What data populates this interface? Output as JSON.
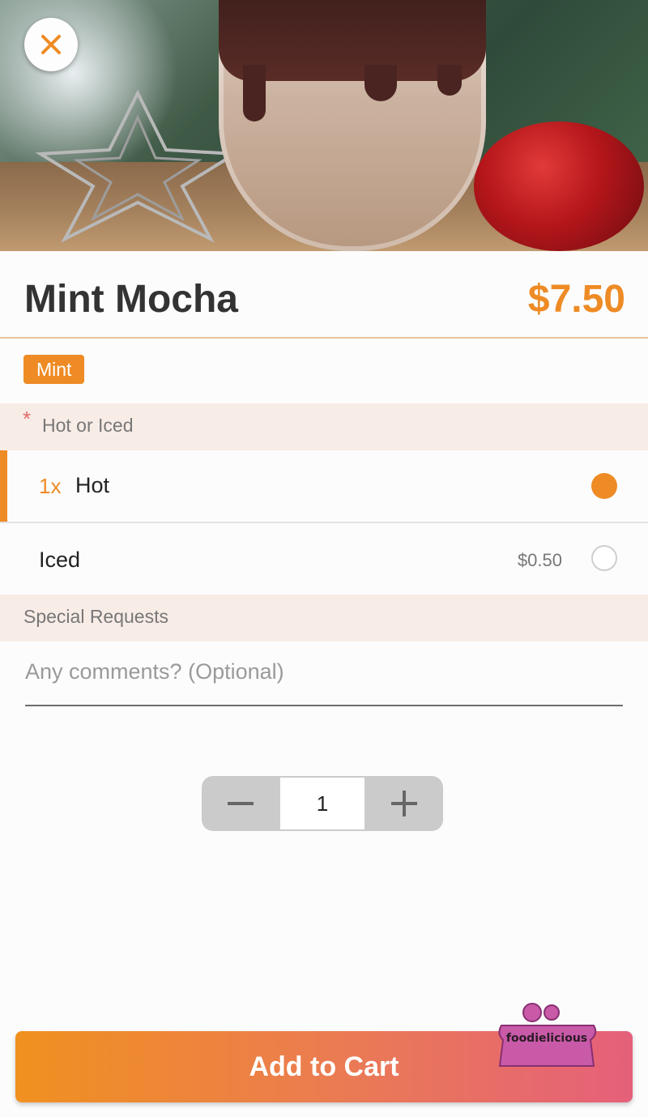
{
  "item": {
    "name": "Mint Mocha",
    "price": "$7.50",
    "tag": "Mint"
  },
  "hero": {
    "image_name": "hero-drink-photo"
  },
  "options": {
    "section_title": "Hot or Iced",
    "required_marker": "*",
    "items": [
      {
        "prefix": "1x",
        "label": "Hot",
        "price": "",
        "selected": true
      },
      {
        "prefix": "",
        "label": "Iced",
        "price": "$0.50",
        "selected": false
      }
    ]
  },
  "special": {
    "section_title": "Special Requests",
    "placeholder": "Any comments? (Optional)",
    "value": ""
  },
  "quantity": {
    "value": "1"
  },
  "cart": {
    "label": "Add to Cart"
  },
  "watermark": {
    "text": "foodielicious"
  },
  "colors": {
    "accent": "#ee8b25",
    "section_bg": "#f8ece6",
    "gradient_end": "#e5607a"
  },
  "icons": {
    "close": "close-icon",
    "minus": "minus-icon",
    "plus": "plus-icon"
  }
}
